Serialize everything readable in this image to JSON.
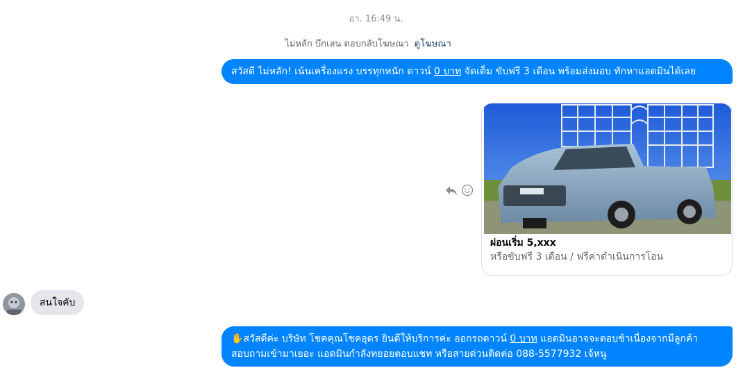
{
  "timestamp": "อา. 16:49 น.",
  "ad_notice": {
    "text": "ไม่หลัก บึกเลน ตอบกลับโฆษณา",
    "link": "ดูโฆษณา"
  },
  "messages": {
    "outgoing_1": {
      "part1": "สวัสดี ไม่หลัก! เน้นเครื่องแรง บรรทุกหนัก ดาวน์ ",
      "underlined": "0 บาท",
      "part2": " จัดเต็ม ขับฟรี 3 เดือน พร้อมส่งมอบ ทักหาแอดมินได้เลย"
    },
    "ad_card": {
      "image": "pickup-truck-with-steel-cage",
      "title": "ผ่อนเริ่ม 5,xxx",
      "subtitle": "หรือขับฟรี 3 เดือน / ฟรีค่าดำเนินการโอน"
    },
    "incoming_1": {
      "text": "สนใจคับ"
    },
    "outgoing_2": {
      "emoji": "✋",
      "part1": "สวัสดีค่ะ บริษัท โชคคุณโชคอุดร ยินดีให้บริการค่ะ ออกรถดาวน์ ",
      "underlined": "0 บาท",
      "part2": " แอดมินอาจจะตอบช้าเนื่องจากมีลูกค้าสอบถามเข้ามาเยอะ แอดมินกำลังทยอยตอบแชท หรือสายด่วนติดต่อ 088-5577932 เจ้หนู"
    }
  },
  "icons": [
    "reply-icon",
    "react-icon",
    "avatar"
  ],
  "colors": {
    "outgoing_bubble": "#0084ff",
    "incoming_bubble": "#e4e6eb"
  }
}
